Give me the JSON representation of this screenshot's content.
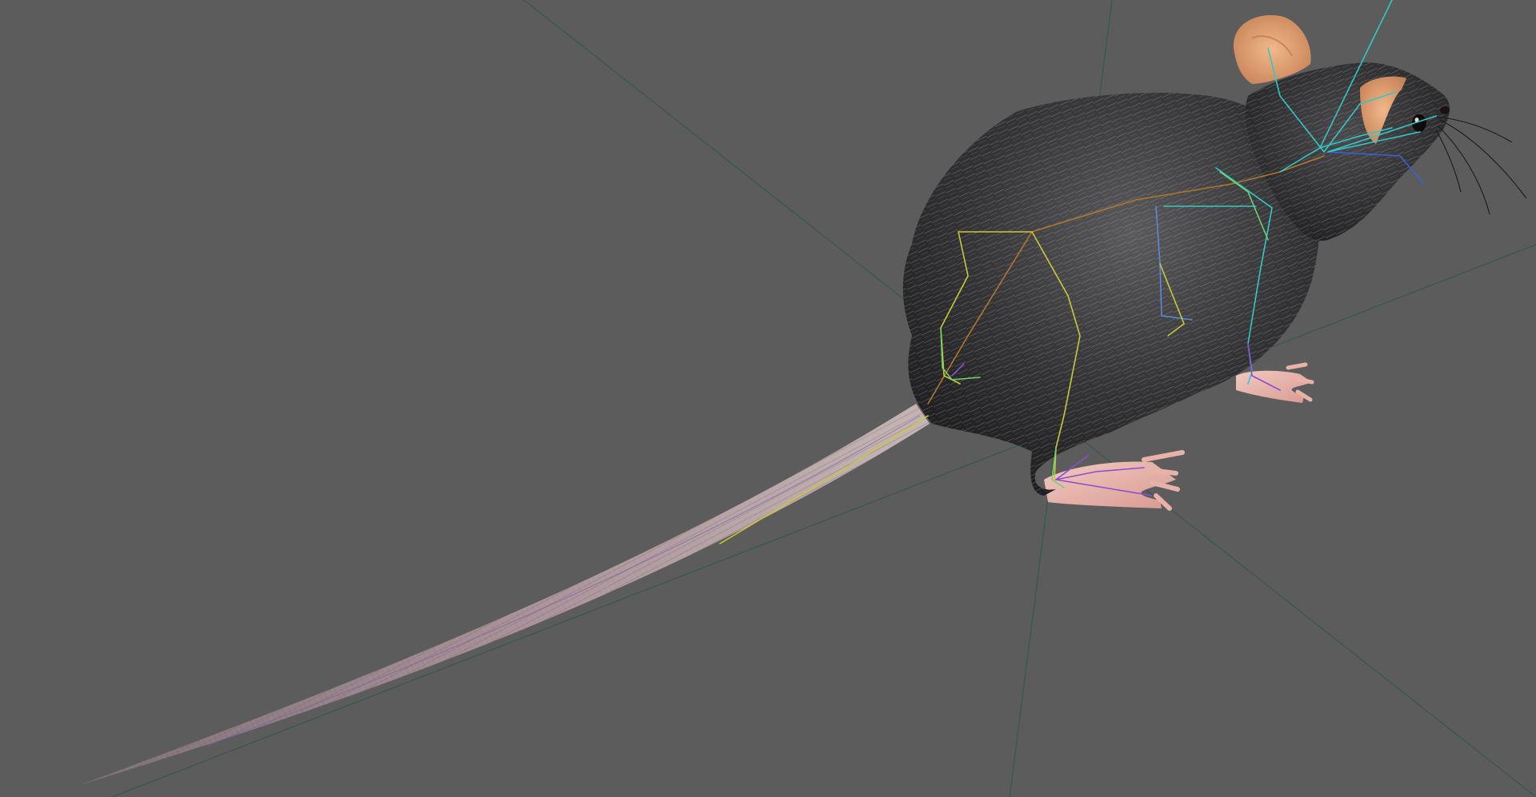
{
  "viewport": {
    "background_color": "#5c5c5c",
    "grid_axis_color": "#2f5a4c",
    "model": {
      "name": "",
      "fur_color": "#2b2b2d",
      "fur_highlight_color": "#9a9a9c",
      "skin_color": "#e7b6a8",
      "ear_color": "#e9a578",
      "tail_color": "#a79096"
    },
    "rig": {
      "bone_colors": [
        "#33c7c8",
        "#c9c83a",
        "#6fd16a",
        "#b0772f",
        "#8a4ed0",
        "#3a62d6"
      ]
    }
  }
}
